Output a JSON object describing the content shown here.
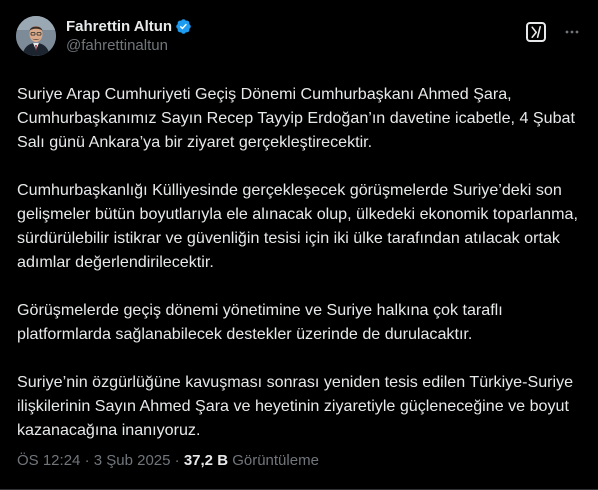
{
  "author": {
    "display_name": "Fahrettin Altun",
    "handle": "@fahrettinaltun",
    "verified": true,
    "verified_badge_color": "#1d9bf0",
    "avatar_icon": "user-avatar"
  },
  "actions": {
    "grok_icon": "grok-icon",
    "more_icon": "more-options-icon"
  },
  "post": {
    "paragraphs": [
      "Suriye Arap Cumhuriyeti Geçiş Dönemi Cumhurbaşkanı Ahmed Şara, Cumhurbaşkanımız Sayın Recep Tayyip Erdoğan’ın davetine icabetle, 4 Şubat Salı günü Ankara’ya bir ziyaret gerçekleştirecektir.",
      "Cumhurbaşkanlığı Külliyesinde gerçekleşecek görüşmelerde Suriye’deki son gelişmeler bütün boyutlarıyla ele alınacak olup, ülkedeki ekonomik toparlanma, sürdürülebilir istikrar ve güvenliğin tesisi için iki ülke tarafından atılacak ortak adımlar değerlendirilecektir.",
      "Görüşmelerde geçiş dönemi yönetimine ve Suriye halkına çok taraflı platformlarda sağlanabilecek destekler üzerinde de durulacaktır.",
      "Suriye’nin özgürlüğüne kavuşması sonrası yeniden tesis edilen Türkiye-Suriye ilişkilerinin Sayın Ahmed Şara ve heyetinin ziyaretiyle güçleneceğine ve boyut kazanacağına inanıyoruz."
    ]
  },
  "meta": {
    "time": "ÖS 12:24",
    "separator": "·",
    "date": "3 Şub 2025",
    "views_count": "37,2 B",
    "views_label": "Görüntüleme"
  },
  "colors": {
    "background": "#000000",
    "text_primary": "#e7e9ea",
    "text_secondary": "#71767b",
    "divider": "#2f3336"
  }
}
